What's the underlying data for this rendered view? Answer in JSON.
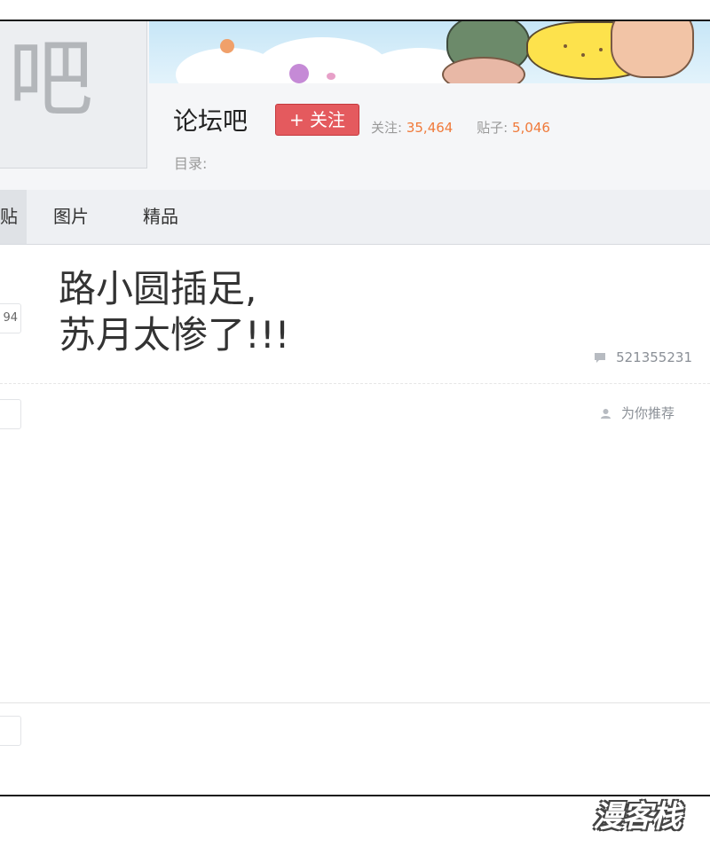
{
  "header": {
    "avatar_text": "吧",
    "forum_name": "论坛吧",
    "follow_label": "+ 关注",
    "follow_stat_label": "关注:",
    "follow_count": "35,464",
    "posts_stat_label": "贴子:",
    "posts_count": "5,046",
    "catalog_label": "目录:"
  },
  "tabs": {
    "active_partial": "看贴",
    "items": [
      "图片",
      "精品"
    ]
  },
  "threads": [
    {
      "reply_count_partial": "94",
      "title_lines": [
        "路小圆插足,",
        "苏月太惨了!!!"
      ],
      "author": "521355231"
    },
    {
      "reply_count_partial": "",
      "recommend_label": "为你推荐"
    },
    {
      "reply_count_partial": ""
    }
  ],
  "watermark": "漫客栈",
  "colors": {
    "follow_button": "#e45a5e",
    "stat_value": "#f07a3a",
    "tab_bar": "#eef0f3"
  },
  "icons": [
    "comment-icon",
    "user-icon"
  ]
}
